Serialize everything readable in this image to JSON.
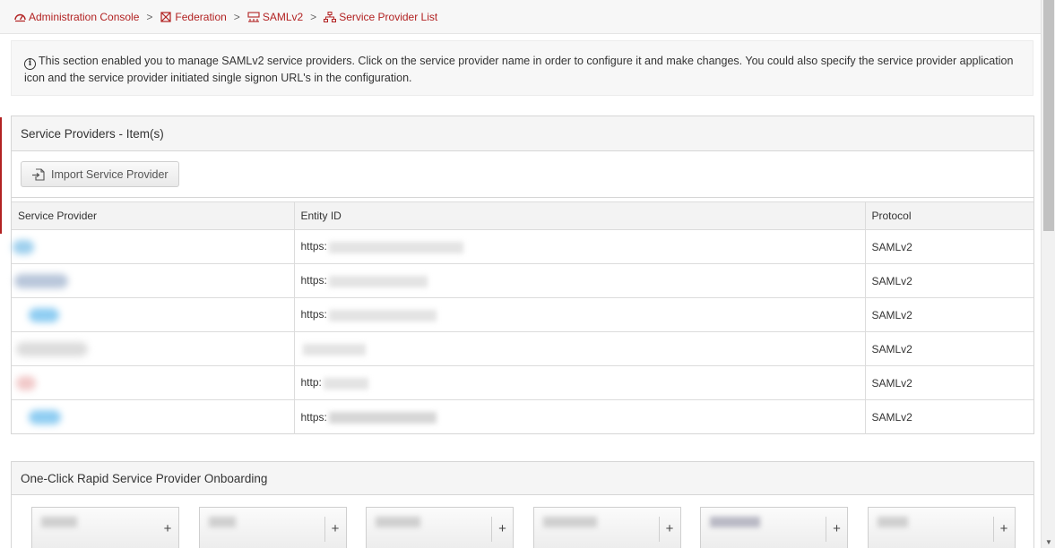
{
  "breadcrumb": {
    "items": [
      {
        "label": "Administration Console",
        "icon": "dashboard-icon"
      },
      {
        "label": "Federation",
        "icon": "federation-icon"
      },
      {
        "label": "SAMLv2",
        "icon": "saml-icon"
      },
      {
        "label": "Service Provider List",
        "icon": "sitemap-icon"
      }
    ],
    "separator": ">"
  },
  "info": {
    "text": "This section enabled you to manage SAMLv2 service providers. Click on the service provider name in order to configure it and make changes. You could also specify the service provider application icon and the service provider initiated single signon URL's in the configuration."
  },
  "service_providers_panel": {
    "title": "Service Providers - Item(s)",
    "import_button": "Import Service Provider",
    "columns": [
      "Service Provider",
      "Entity ID",
      "Protocol"
    ],
    "rows": [
      {
        "entity_id": "https:",
        "protocol": "SAMLv2"
      },
      {
        "entity_id": "https:",
        "protocol": "SAMLv2"
      },
      {
        "entity_id": "https:",
        "protocol": "SAMLv2"
      },
      {
        "entity_id": "",
        "protocol": "SAMLv2"
      },
      {
        "entity_id": "http:",
        "protocol": "SAMLv2"
      },
      {
        "entity_id": "https:",
        "protocol": "SAMLv2"
      }
    ]
  },
  "onboarding_panel": {
    "title": "One-Click Rapid Service Provider Onboarding",
    "tile_add_label": "+"
  },
  "colors": {
    "accent": "#b22222",
    "header_bg": "#f5f5f5"
  }
}
